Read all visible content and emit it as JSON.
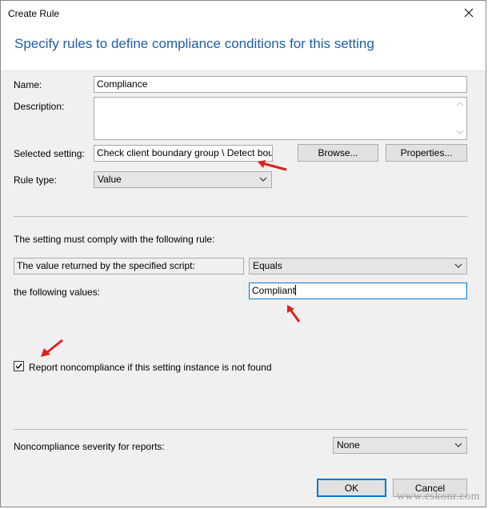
{
  "window": {
    "title": "Create Rule"
  },
  "header": {
    "heading": "Specify rules to define compliance conditions for this setting"
  },
  "form": {
    "name_label": "Name:",
    "name_value": "Compliance",
    "description_label": "Description:",
    "description_value": "",
    "selected_setting_label": "Selected setting:",
    "selected_setting_value": "Check client boundary group \\ Detect bounda",
    "browse_label": "Browse...",
    "properties_label": "Properties...",
    "rule_type_label": "Rule type:",
    "rule_type_value": "Value"
  },
  "rule": {
    "instruction": "The setting must comply with the following rule:",
    "source_label": "The value returned by the specified script:",
    "operator_value": "Equals",
    "values_label": "the following values:",
    "values_value": "Compliant",
    "report_checkbox_label": "Report noncompliance if this setting instance is not found",
    "report_checked": true
  },
  "severity": {
    "label": "Noncompliance severity for reports:",
    "value": "None"
  },
  "footer": {
    "ok_label": "OK",
    "cancel_label": "Cancel"
  },
  "watermark": "www.eskonr.com",
  "colors": {
    "heading": "#1e5da8",
    "arrow": "#e0201c",
    "focus": "#0078d7"
  }
}
